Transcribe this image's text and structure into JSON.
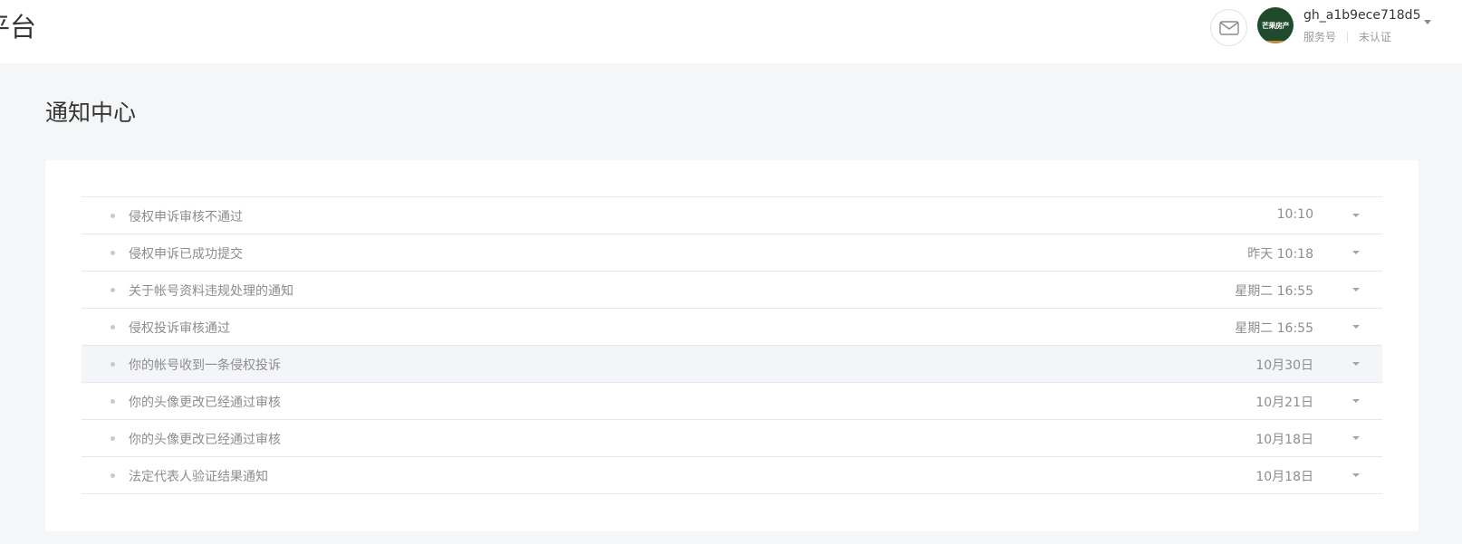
{
  "header": {
    "brand_fragment": "平台",
    "account": {
      "name": "gh_a1b9ece718d5",
      "type": "服务号",
      "verification": "未认证",
      "avatar_text": "芒果房产"
    },
    "icons": {
      "mail": "mail-icon",
      "account_menu": "chevron-down-icon"
    }
  },
  "page": {
    "title": "通知中心"
  },
  "notifications": [
    {
      "title": "侵权申诉审核不通过",
      "time": "10:10"
    },
    {
      "title": "侵权申诉已成功提交",
      "time": "昨天 10:18"
    },
    {
      "title": "关于帐号资料违规处理的通知",
      "time": "星期二 16:55"
    },
    {
      "title": "侵权投诉审核通过",
      "time": "星期二 16:55"
    },
    {
      "title": "你的帐号收到一条侵权投诉",
      "time": "10月30日"
    },
    {
      "title": "你的头像更改已经通过审核",
      "time": "10月21日"
    },
    {
      "title": "你的头像更改已经通过审核",
      "time": "10月18日"
    },
    {
      "title": "法定代表人验证结果通知",
      "time": "10月18日"
    }
  ],
  "colors": {
    "background": "#f5f6f7",
    "card": "#ffffff",
    "divider": "#e7e7eb",
    "row_hover": "#f4f5f9",
    "muted_text": "#8d8d8d",
    "avatar_bg": "#1f4a2c"
  }
}
